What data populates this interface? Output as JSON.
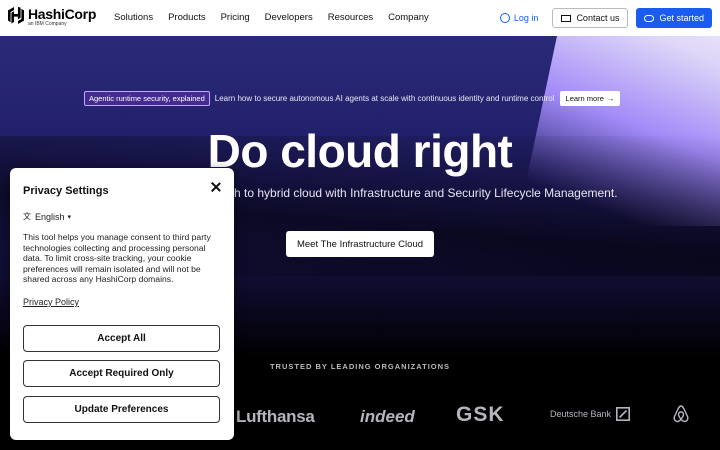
{
  "nav": {
    "logo_name": "HashiCorp",
    "logo_sub": "an IBM Company",
    "links": [
      "Solutions",
      "Products",
      "Pricing",
      "Developers",
      "Resources",
      "Company"
    ],
    "login_label": "Log in",
    "contact_label": "Contact us",
    "start_label": "Get started",
    "accent_color": "#1a5cf0"
  },
  "hero": {
    "tag": "Agentic runtime security, explained",
    "banner_text": "Learn how to secure autonomous AI agents at scale with continuous identity and runtime control",
    "learn_more": "Learn more",
    "heading": "Do cloud right",
    "subheading": "ch to hybrid cloud with Infrastructure and Security Lifecycle Management.",
    "cta": "Meet The Infrastructure Cloud",
    "trusted": "TRUSTED BY LEADING ORGANIZATIONS",
    "logos": [
      "Lufthansa",
      "indeed",
      "GSK",
      "Deutsche Bank",
      "airbnb-icon"
    ]
  },
  "privacy": {
    "title": "Privacy Settings",
    "language": "English",
    "description": "This tool helps you manage consent to third party technologies collecting and processing personal data. To limit cross-site tracking, your cookie preferences will remain isolated and will not be shared across any HashiCorp domains.",
    "policy_link": "Privacy Policy",
    "accept_all": "Accept All",
    "accept_required": "Accept Required Only",
    "update_prefs": "Update Preferences"
  }
}
